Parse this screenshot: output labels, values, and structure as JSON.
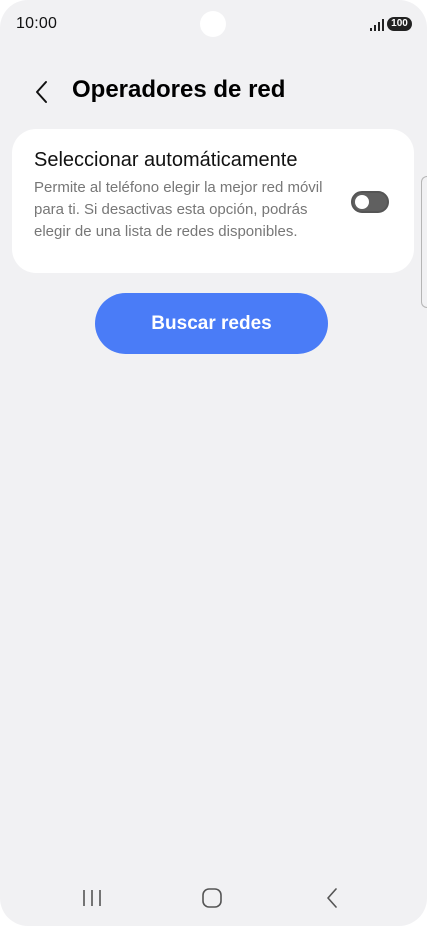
{
  "status_bar": {
    "time": "10:00",
    "battery": "100",
    "icons": [
      "signal-icon",
      "battery-icon"
    ]
  },
  "header": {
    "title": "Operadores de red",
    "back_icon": "chevron-left-icon"
  },
  "auto_select": {
    "title": "Seleccionar automáticamente",
    "description": "Permite al teléfono elegir la mejor red móvil para ti. Si desactivas esta opción, podrás elegir de una lista de redes disponibles.",
    "enabled": false
  },
  "search_button": {
    "label": "Buscar redes"
  },
  "nav_bar": {
    "items": [
      "recent-apps-icon",
      "home-icon",
      "back-icon"
    ]
  },
  "colors": {
    "background": "#f1f1f3",
    "card": "#ffffff",
    "accent": "#4a7cf7",
    "toggle_off": "#606060"
  }
}
